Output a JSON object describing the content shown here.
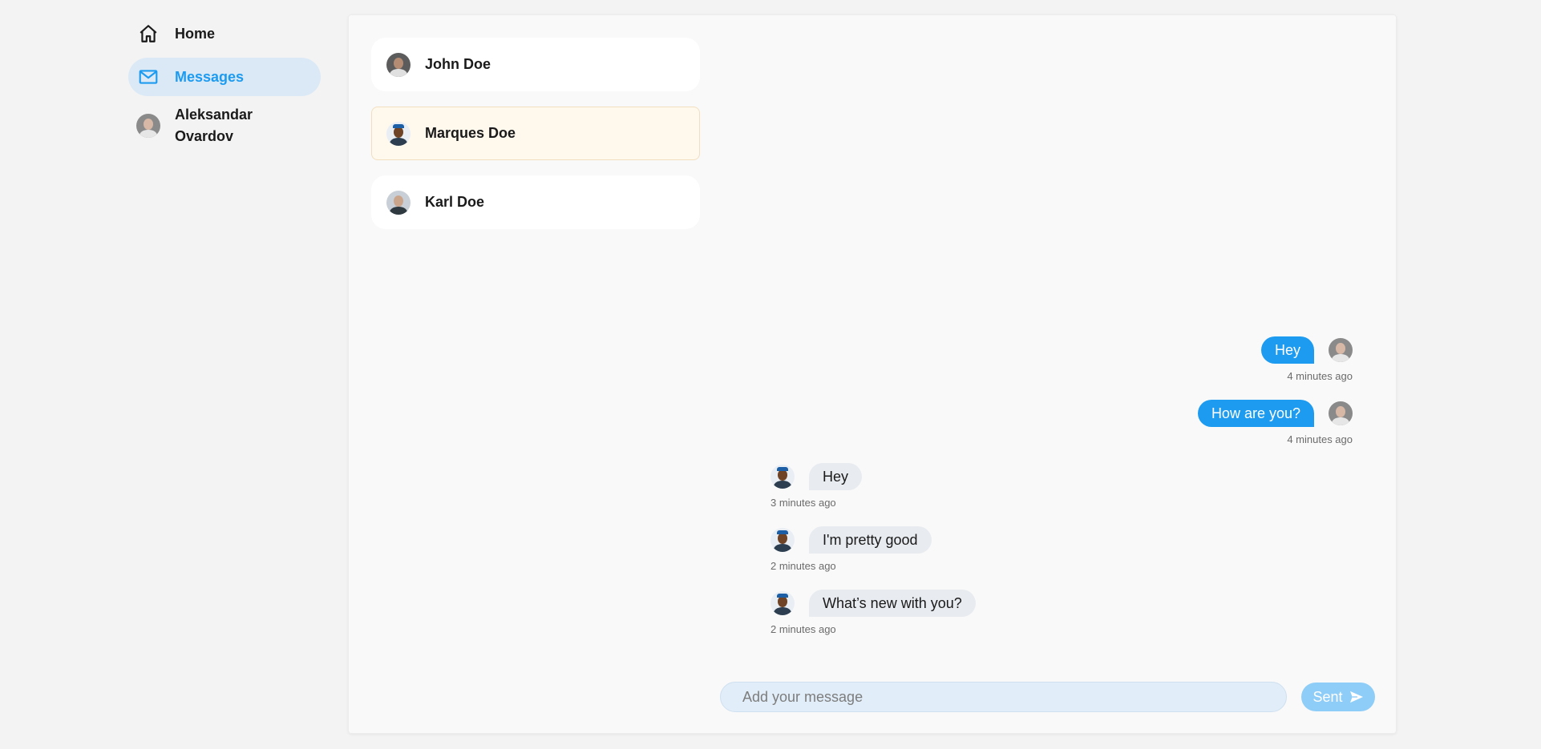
{
  "sidebar": {
    "items": [
      {
        "label": "Home",
        "icon": "home-icon",
        "active": false
      },
      {
        "label": "Messages",
        "icon": "mail-icon",
        "active": true
      }
    ],
    "profile": {
      "name_line1": "Aleksandar",
      "name_line2": "Ovardov"
    }
  },
  "contacts": [
    {
      "name": "John Doe",
      "selected": false
    },
    {
      "name": "Marques Doe",
      "selected": true
    },
    {
      "name": "Karl Doe",
      "selected": false
    }
  ],
  "messages": [
    {
      "direction": "out",
      "text": "Hey",
      "time": "4 minutes ago"
    },
    {
      "direction": "out",
      "text": "How are you?",
      "time": "4 minutes ago"
    },
    {
      "direction": "in",
      "text": "Hey",
      "time": "3 minutes ago"
    },
    {
      "direction": "in",
      "text": "I'm pretty good",
      "time": "2 minutes ago"
    },
    {
      "direction": "in",
      "text": "What’s new with you?",
      "time": "2 minutes ago"
    }
  ],
  "composer": {
    "placeholder": "Add your message",
    "value": ""
  },
  "send_button": {
    "label": "Sent",
    "icon": "send-icon"
  },
  "colors": {
    "accent": "#1d9bf0",
    "active_nav_bg": "#dbe9f6",
    "selected_contact_bg": "#fff8ed",
    "incoming_bubble": "#e8ebef",
    "send_button_disabled": "#8ecdf7"
  }
}
